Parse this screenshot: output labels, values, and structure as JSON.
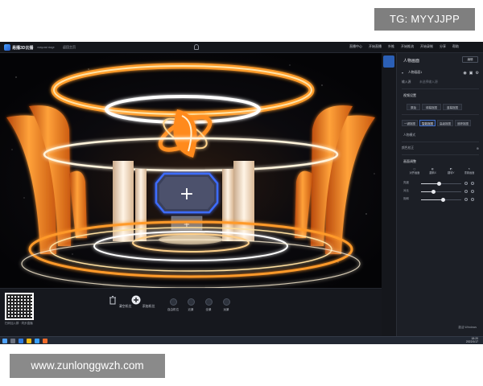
{
  "watermarks": {
    "tg": "TG: MYYJJPP",
    "url": "www.zunlonggwzh.com"
  },
  "topbar": {
    "app_name": "易播3D云播",
    "app_sub": "easycast stage",
    "link": "返回主页",
    "actions": [
      "直播中心",
      "开始直播",
      "外推",
      "开始推流",
      "开始录制",
      "分享",
      "帮助"
    ]
  },
  "right_panel": {
    "title": "人物画面",
    "edit_button": "编辑",
    "layer_name": "人物画面1",
    "input_label": "输入源",
    "input_value": "未选择输入源",
    "section_display": "视频设置",
    "display_chips": [
      "原始",
      "绿幕抠图",
      "蓝幕抠图"
    ],
    "effect_chips": [
      "一键抠图",
      "智能抠图",
      "高级抠图",
      "追踪抠图"
    ],
    "section_mode": "人物模式",
    "section_color": "颜色校正",
    "color_label": "颜色校正",
    "section_adjust": "画面调整",
    "adjust_icons": [
      "对齐画面",
      "翻转X",
      "翻转Y",
      "重置画面"
    ],
    "sliders": [
      {
        "label": "亮度",
        "value": 0.45
      },
      {
        "label": "对比",
        "value": 0.3
      },
      {
        "label": "饱和",
        "value": 0.55
      }
    ],
    "footer": "激活 Windows"
  },
  "bottom_panel": {
    "qr_caption": "扫码加入群 · 同步直播",
    "tools": [
      {
        "label": "清空机位",
        "icon": "trash-icon"
      },
      {
        "label": "添加机位",
        "icon": "plus-circle-icon"
      }
    ],
    "cameras": [
      "自由机位",
      "近景",
      "全景",
      "远景"
    ]
  },
  "taskbar": {
    "time": "18:20",
    "date": "2022/1/17"
  },
  "colors": {
    "accent": "#2b5fb5",
    "stage_orange": "#ff8a1f",
    "glow": "#ffe2a8",
    "screen_frame": "#2f5bd4"
  }
}
